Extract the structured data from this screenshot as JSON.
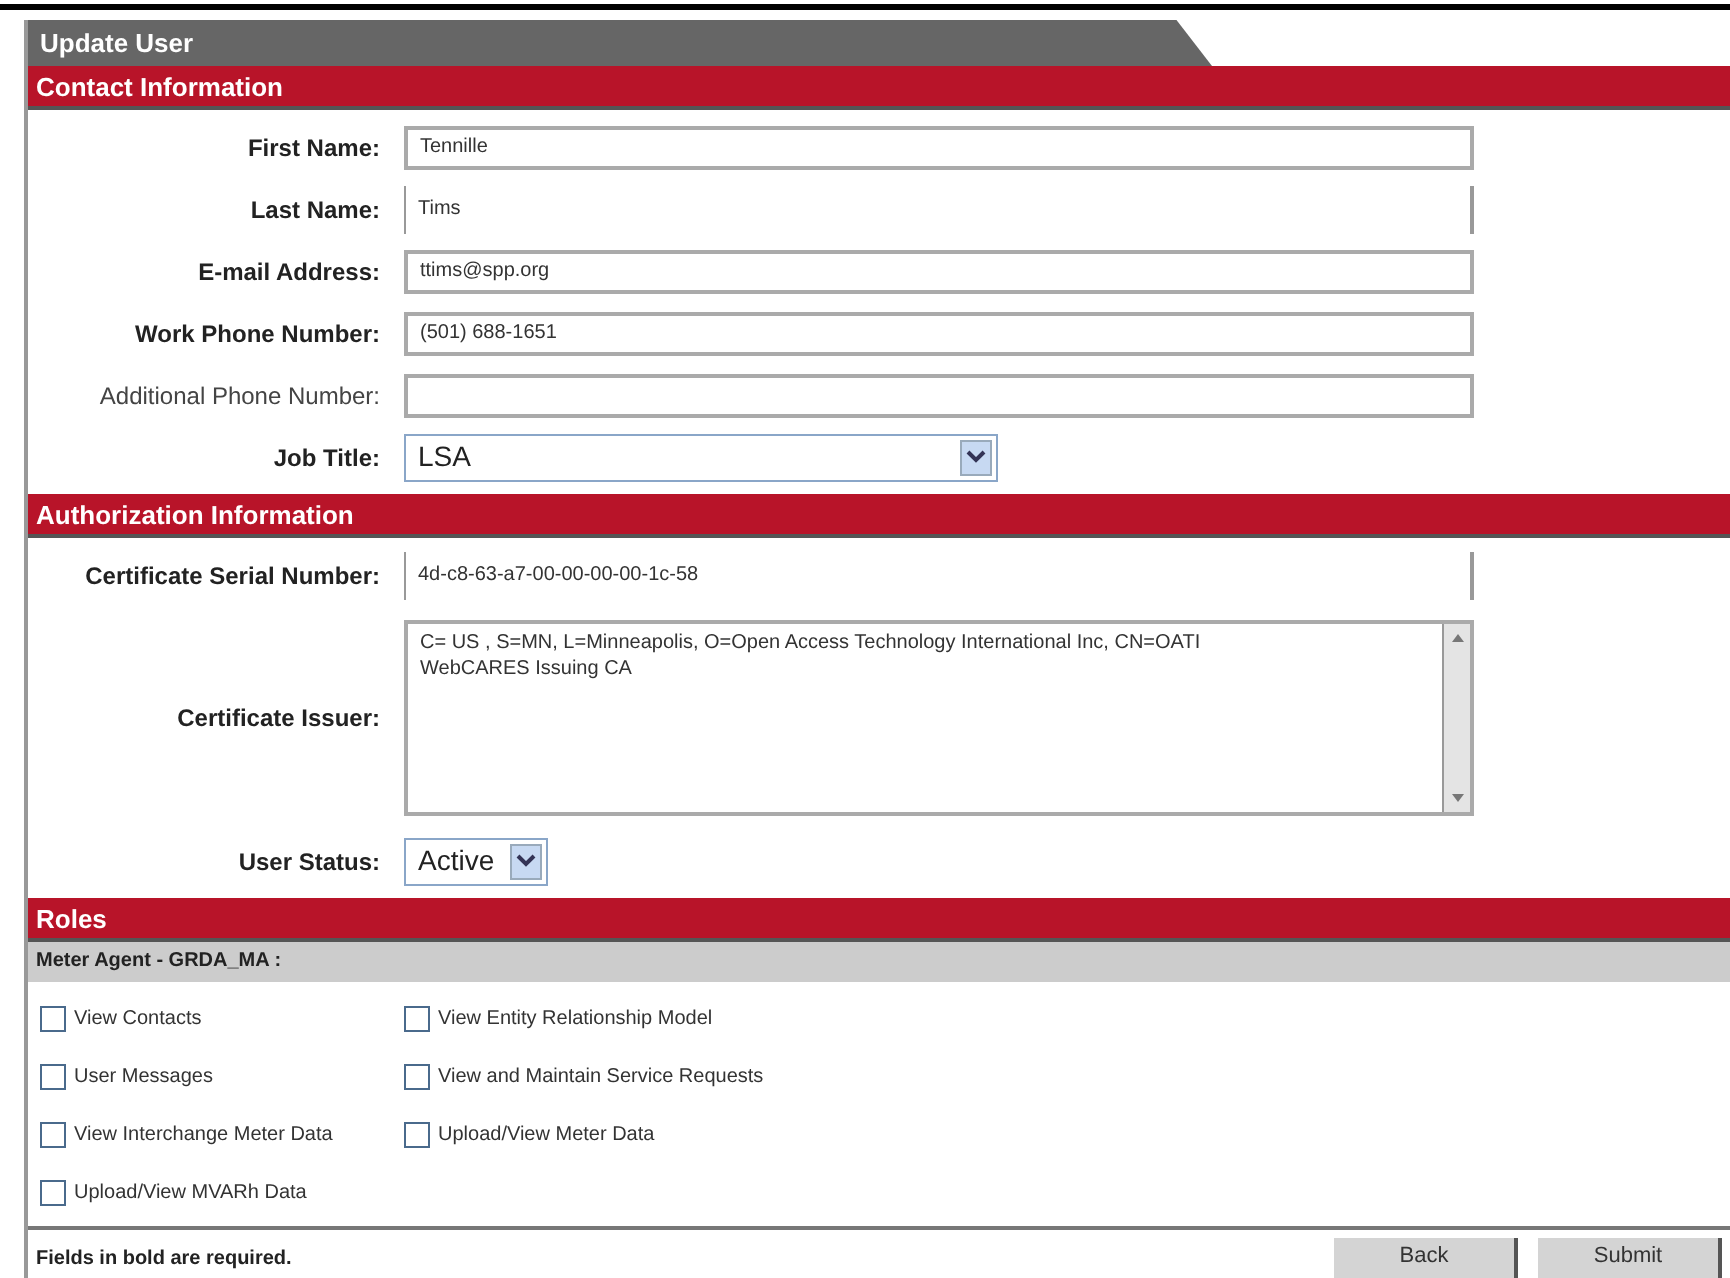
{
  "tab": {
    "title": "Update User"
  },
  "sections": [
    {
      "title": "Contact Information",
      "fields": [
        {
          "label": "First Name:",
          "required": true,
          "kind": "text",
          "value": "Tennille"
        },
        {
          "label": "Last Name:",
          "required": true,
          "kind": "readonly",
          "value": "Tims"
        },
        {
          "label": "E-mail Address:",
          "required": true,
          "kind": "text",
          "value": "ttims@spp.org"
        },
        {
          "label": "Work Phone Number:",
          "required": true,
          "kind": "text",
          "value": "(501) 688-1651"
        },
        {
          "label": "Additional Phone Number:",
          "required": false,
          "kind": "text"
        },
        {
          "label": "Job Title:",
          "required": true,
          "kind": "select",
          "value": "LSA"
        }
      ]
    },
    {
      "title": "Authorization Information",
      "fields": [
        {
          "label": "Certificate Serial Number:",
          "required": true,
          "kind": "readonly",
          "value": "4d-c8-63-a7-00-00-00-00-1c-58"
        },
        {
          "label": "Certificate Issuer:",
          "required": true,
          "kind": "textarea",
          "value": "C= US , S=MN, L=Minneapolis, O=Open Access Technology International Inc, CN=OATI WebCARES Issuing CA"
        },
        {
          "label": "User Status:",
          "required": true,
          "kind": "short_select",
          "value": "Active"
        }
      ]
    }
  ],
  "roles": {
    "title": "Roles",
    "group": "Meter Agent - GRDA_MA :",
    "items": [
      {
        "label": "View Contacts",
        "checked": false
      },
      {
        "label": "View Entity Relationship Model",
        "checked": false
      },
      {
        "label": "User Messages",
        "checked": false
      },
      {
        "label": "View and Maintain Service Requests",
        "checked": false
      },
      {
        "label": "View Interchange Meter Data",
        "checked": false
      },
      {
        "label": "Upload/View Meter Data",
        "checked": false
      },
      {
        "label": "Upload/View MVARh Data",
        "checked": false
      }
    ]
  },
  "footer": {
    "note": "Fields in bold are required.",
    "buttons": [
      "Back",
      "Submit"
    ]
  }
}
